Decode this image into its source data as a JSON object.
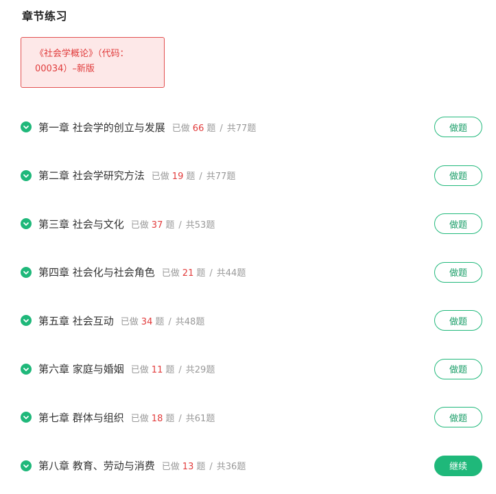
{
  "section_title": "章节练习",
  "course": {
    "name_line1": "《社会学概论》（代码：",
    "name_line2": "00034）–新版"
  },
  "labels": {
    "done_prefix": "已做",
    "question_unit": "题",
    "separator": "/",
    "total_prefix": "共",
    "total_suffix": "题"
  },
  "chapters": [
    {
      "name": "第一章 社会学的创立与发展",
      "done": "66",
      "total": "77",
      "button": "做题",
      "button_style": "outline"
    },
    {
      "name": "第二章 社会学研究方法",
      "done": "19",
      "total": "77",
      "button": "做题",
      "button_style": "outline"
    },
    {
      "name": "第三章 社会与文化",
      "done": "37",
      "total": "53",
      "button": "做题",
      "button_style": "outline"
    },
    {
      "name": "第四章 社会化与社会角色",
      "done": "21",
      "total": "44",
      "button": "做题",
      "button_style": "outline"
    },
    {
      "name": "第五章 社会互动",
      "done": "34",
      "total": "48",
      "button": "做题",
      "button_style": "outline"
    },
    {
      "name": "第六章 家庭与婚姻",
      "done": "11",
      "total": "29",
      "button": "做题",
      "button_style": "outline"
    },
    {
      "name": "第七章 群体与组织",
      "done": "18",
      "total": "61",
      "button": "做题",
      "button_style": "outline"
    },
    {
      "name": "第八章 教育、劳动与消费",
      "done": "13",
      "total": "36",
      "button": "继续",
      "button_style": "filled"
    }
  ],
  "colors": {
    "accent_green": "#1fb87a",
    "highlight_red": "#e23b3b",
    "card_background": "#fde8e8",
    "card_border": "#e24f4f"
  },
  "icons": {
    "chapter_status": "check-circle-icon"
  }
}
